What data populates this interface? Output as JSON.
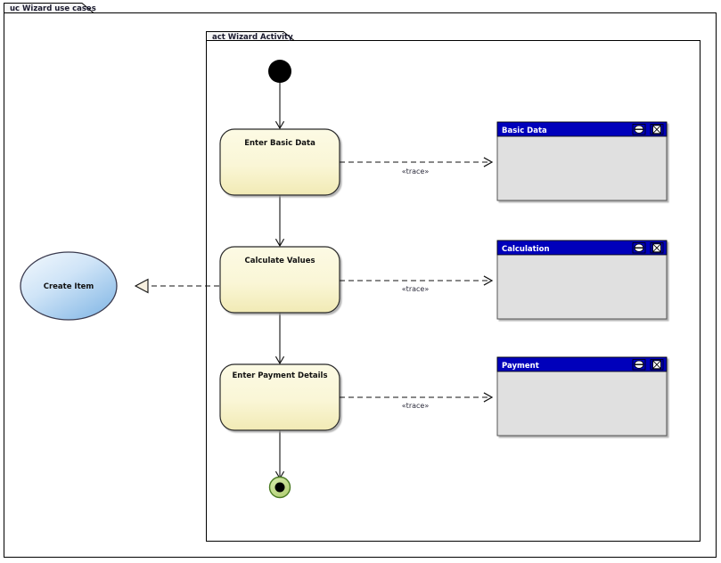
{
  "outer_frame": {
    "label": "uc Wizard use cases"
  },
  "activity_frame": {
    "label": "act Wizard Activity"
  },
  "use_case": {
    "label": "Create Item",
    "shape": "ellipse",
    "fill_start": "#f2f8fd",
    "fill_end": "#8cbce8",
    "stroke": "#3b3b4f"
  },
  "initial_node": {
    "name": "initial-node",
    "fill": "#000000"
  },
  "final_node": {
    "name": "activity-final-node",
    "ring_fill": "#c5dd8a",
    "inner_fill": "#000000",
    "stroke": "#4a7a22"
  },
  "activities": [
    {
      "label": "Enter Basic Data",
      "fill_start": "#fbf8dd",
      "fill_end": "#f2ecbb",
      "stroke": "#2b2b2b"
    },
    {
      "label": "Calculate Values",
      "fill_start": "#fbf8dd",
      "fill_end": "#f2ecbb",
      "stroke": "#2b2b2b"
    },
    {
      "label": "Enter Payment Details",
      "fill_start": "#fbf8dd",
      "fill_end": "#f2ecbb",
      "stroke": "#2b2b2b"
    }
  ],
  "screens": [
    {
      "title": "Basic Data",
      "titlebar_color": "#0000bb",
      "body_color": "#e0e0e0",
      "minimize_icon": "minimize-icon",
      "close_icon": "close-icon"
    },
    {
      "title": "Calculation",
      "titlebar_color": "#0000bb",
      "body_color": "#e0e0e0",
      "minimize_icon": "minimize-icon",
      "close_icon": "close-icon"
    },
    {
      "title": "Payment",
      "titlebar_color": "#0000bb",
      "body_color": "#e0e0e0",
      "minimize_icon": "minimize-icon",
      "close_icon": "close-icon"
    }
  ],
  "trace_links": [
    {
      "label": "«trace»"
    },
    {
      "label": "«trace»"
    },
    {
      "label": "«trace»"
    }
  ],
  "realization_link": {
    "label": ""
  }
}
